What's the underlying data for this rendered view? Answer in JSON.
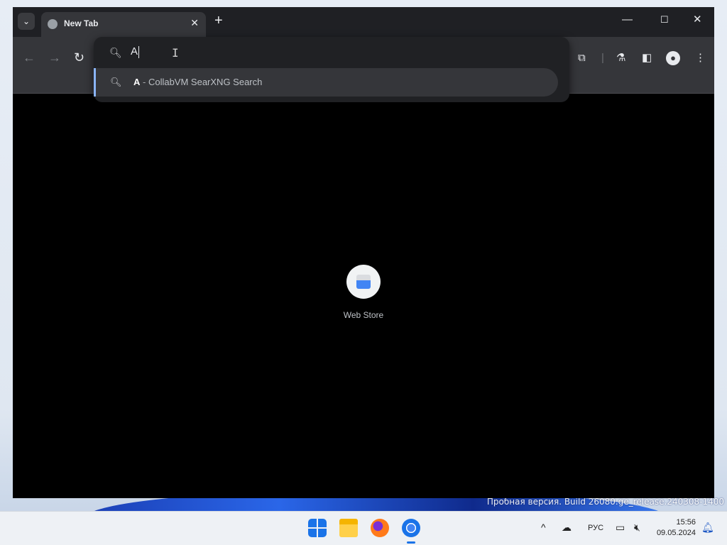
{
  "browser": {
    "tab": {
      "title": "New Tab"
    },
    "omnibox": {
      "value": "A",
      "suggestion": {
        "match": "A",
        "separator": " - ",
        "engine": "CollabVM SearXNG Search"
      }
    }
  },
  "new_tab_page": {
    "shortcuts": [
      {
        "label": "Web Store"
      }
    ]
  },
  "desktop": {
    "watermark": "Пробная версия. Build 26080.ge_release.240308-1400"
  },
  "taskbar": {
    "language": "РУС",
    "time": "15:56",
    "date": "09.05.2024"
  },
  "icons": {
    "tab_search": "chevron-down-icon",
    "favicon": "globe-icon",
    "back": "arrow-left-icon",
    "forward": "arrow-right-icon",
    "reload": "reload-icon",
    "search": "search-icon",
    "extensions": "puzzle-icon",
    "labs": "flask-icon",
    "side_panel": "side-panel-icon",
    "profile": "profile-icon",
    "menu": "kebab-menu-icon"
  },
  "colors": {
    "accent": "#8ab4f8",
    "toolbar": "#35363a",
    "tabstrip": "#1f2024",
    "page_bg": "#000000"
  }
}
